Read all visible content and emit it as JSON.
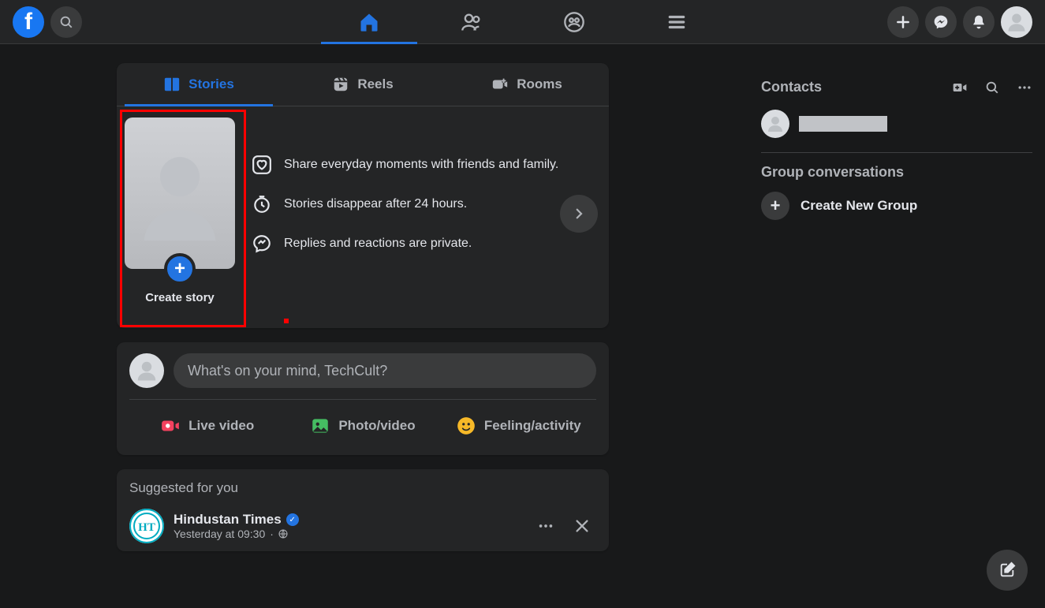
{
  "header": {
    "logo_letter": "f"
  },
  "stories": {
    "tabs": {
      "stories": "Stories",
      "reels": "Reels",
      "rooms": "Rooms"
    },
    "create_label": "Create story",
    "info1": "Share everyday moments with friends and family.",
    "info2": "Stories disappear after 24 hours.",
    "info3": "Replies and reactions are private."
  },
  "composer": {
    "placeholder": "What's on your mind, TechCult?",
    "live_video": "Live video",
    "photo_video": "Photo/video",
    "feeling": "Feeling/activity"
  },
  "suggested": {
    "title": "Suggested for you",
    "name": "Hindustan Times",
    "avatar_text": "HT",
    "time": "Yesterday at 09:30",
    "separator": " · "
  },
  "rightbar": {
    "contacts_title": "Contacts",
    "group_title": "Group conversations",
    "create_group": "Create New Group"
  }
}
